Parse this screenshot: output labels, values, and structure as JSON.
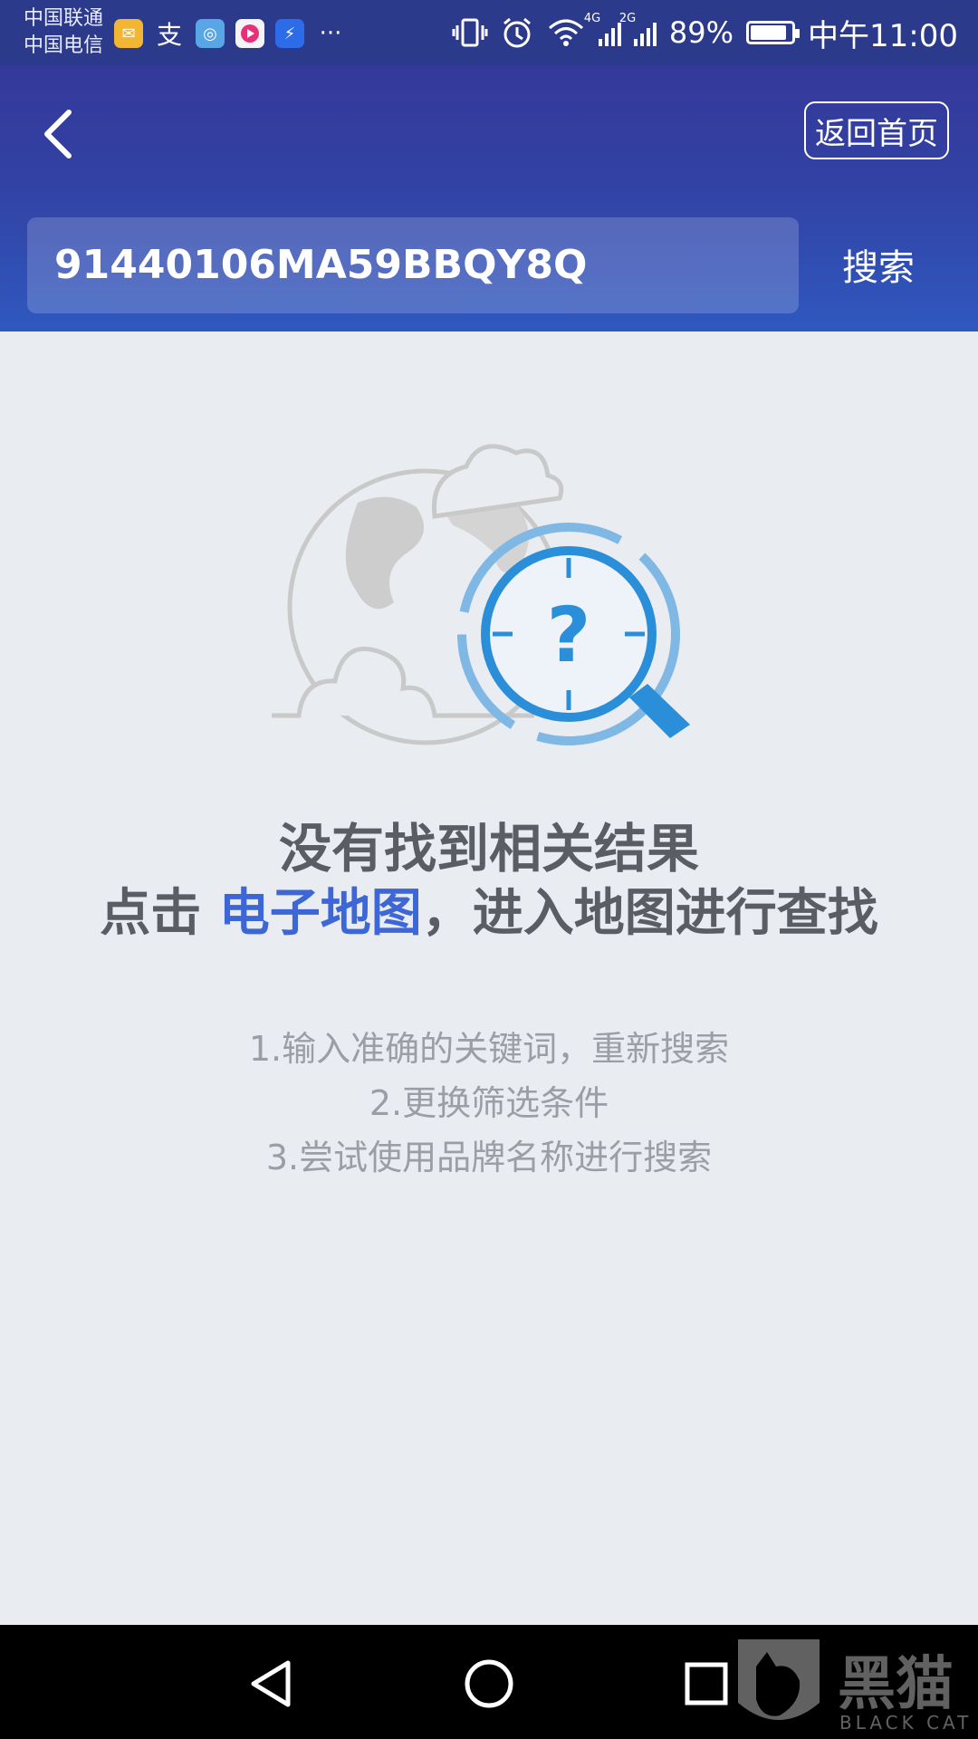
{
  "status_bar": {
    "carrier_1": "中国联通",
    "carrier_2": "中国电信",
    "notification_icons": [
      "mail-icon",
      "alipay-icon",
      "browser-icon",
      "youku-icon",
      "bolt-icon",
      "more-icon"
    ],
    "network_1": "4G",
    "network_2": "2G",
    "battery_percent": "89%",
    "battery_level": 0.89,
    "time": "中午11:00"
  },
  "header": {
    "home_button_label": "返回首页",
    "search_value": "91440106MA59BBQY8Q",
    "search_button_label": "搜索"
  },
  "empty_state": {
    "title": "没有找到相关结果",
    "map_hint_prefix": "点击 ",
    "map_link": "电子地图",
    "map_hint_suffix": "，进入地图进行查找",
    "tips": [
      "1.输入准确的关键词，重新搜索",
      "2.更换筛选条件",
      "3.尝试使用品牌名称进行搜索"
    ]
  },
  "watermark": {
    "text": "黑猫",
    "subtext": "BLACK CAT"
  },
  "colors": {
    "header_top": "#34399a",
    "header_bottom": "#2f58bf",
    "background": "#e9ecf1",
    "link": "#3d67d6",
    "accent_icon": "#2a8fd8"
  }
}
